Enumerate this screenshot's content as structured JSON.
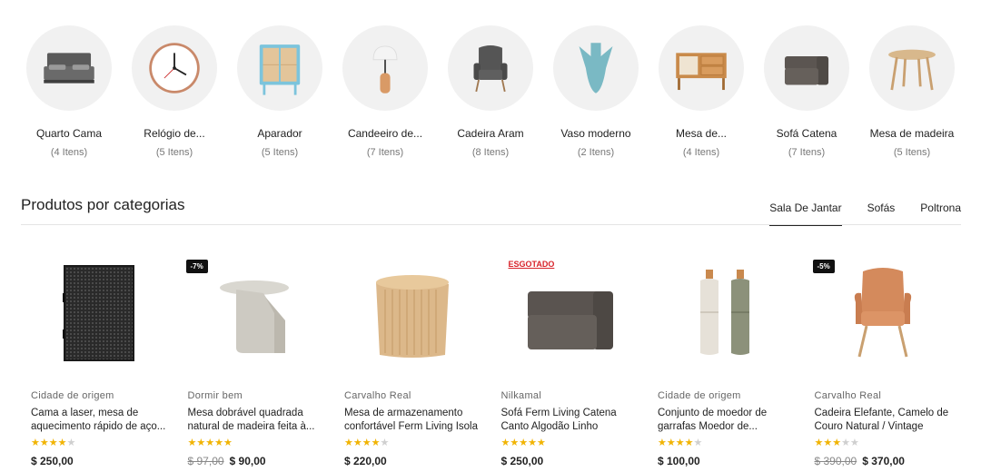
{
  "categories": [
    {
      "name": "Quarto Cama",
      "count": "(4 Itens)",
      "icon": "bed-icon"
    },
    {
      "name": "Relógio de...",
      "count": "(5 Itens)",
      "icon": "clock-icon"
    },
    {
      "name": "Aparador",
      "count": "(5 Itens)",
      "icon": "sideboard-icon"
    },
    {
      "name": "Candeeiro de...",
      "count": "(7 Itens)",
      "icon": "lamp-icon"
    },
    {
      "name": "Cadeira Aram",
      "count": "(8 Itens)",
      "icon": "armchair-icon"
    },
    {
      "name": "Vaso moderno",
      "count": "(2 Itens)",
      "icon": "vase-icon"
    },
    {
      "name": "Mesa de...",
      "count": "(4 Itens)",
      "icon": "desk-icon"
    },
    {
      "name": "Sofá Catena",
      "count": "(7 Itens)",
      "icon": "sofa-icon"
    },
    {
      "name": "Mesa de madeira",
      "count": "(5 Itens)",
      "icon": "round-table-icon"
    }
  ],
  "section": {
    "title": "Produtos por categorias",
    "tabs": [
      "Sala De Jantar",
      "Sofás",
      "Poltrona"
    ],
    "active_tab": "Sala De Jantar"
  },
  "products": [
    {
      "brand": "Cidade de origem",
      "name": "Cama a laser, mesa de aquecimento rápido de aço...",
      "rating": 4,
      "price": "$ 250,00",
      "old_price": "",
      "badge": ""
    },
    {
      "brand": "Dormir bem",
      "name": "Mesa dobrável quadrada natural de madeira feita à...",
      "rating": 5,
      "price": "$ 90,00",
      "old_price": "$ 97,00",
      "badge": "-7%"
    },
    {
      "brand": "Carvalho Real",
      "name": "Mesa de armazenamento confortável Ferm Living Isola",
      "rating": 4,
      "price": "$ 220,00",
      "old_price": "",
      "badge": ""
    },
    {
      "brand": "Nilkamal",
      "name": "Sofá Ferm Living Catena Canto Algodão Linho",
      "rating": 5,
      "price": "$ 250,00",
      "old_price": "",
      "badge": "ESGOTADO"
    },
    {
      "brand": "Cidade de origem",
      "name": "Conjunto de moedor de garrafas Moedor de...",
      "rating": 4,
      "price": "$ 100,00",
      "old_price": "",
      "badge": ""
    },
    {
      "brand": "Carvalho Real",
      "name": "Cadeira Elefante, Camelo de Couro Natural / Vintage",
      "rating": 3,
      "price": "$ 370,00",
      "old_price": "$ 390,00",
      "badge": "-5%"
    }
  ],
  "colors": {
    "star": "#f1b404",
    "star_empty": "#cfcfcf",
    "sold_out": "#d8232a",
    "badge_bg": "#111111"
  }
}
